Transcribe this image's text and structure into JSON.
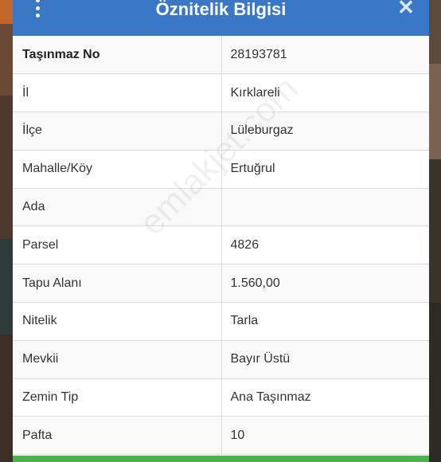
{
  "dialog": {
    "title": "Öznitelik Bilgisi",
    "accent": "#3a78c6",
    "footer_color": "#4caf50"
  },
  "watermark": "emlakjet.com",
  "rows": [
    {
      "key": "Taşınmaz No",
      "value": "28193781"
    },
    {
      "key": "İl",
      "value": "Kırklareli"
    },
    {
      "key": "İlçe",
      "value": "Lüleburgaz"
    },
    {
      "key": "Mahalle/Köy",
      "value": "Ertuğrul"
    },
    {
      "key": "Ada",
      "value": ""
    },
    {
      "key": "Parsel",
      "value": "4826"
    },
    {
      "key": "Tapu Alanı",
      "value": "1.560,00"
    },
    {
      "key": "Nitelik",
      "value": "Tarla"
    },
    {
      "key": "Mevkii",
      "value": "Bayır Üstü"
    },
    {
      "key": "Zemin Tip",
      "value": "Ana Taşınmaz"
    },
    {
      "key": "Pafta",
      "value": "10"
    }
  ],
  "icons": {
    "menu": "kebab-menu-icon",
    "close": "close-icon"
  }
}
